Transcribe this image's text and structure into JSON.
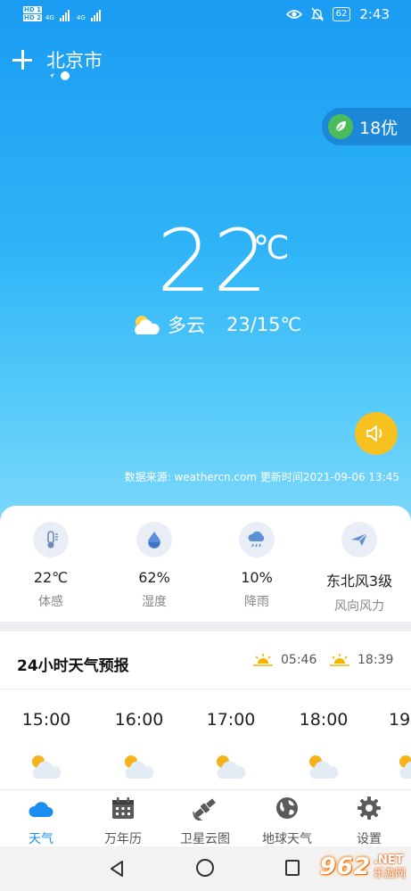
{
  "status_bar": {
    "sim1": "HD 1",
    "sim2": "HD 2",
    "net1": "4G",
    "net2": "4G",
    "battery": "62",
    "time": "2:43"
  },
  "header": {
    "city": "北京市",
    "add_icon": "plus-icon",
    "location_icon": "location-arrow-icon"
  },
  "air_quality": {
    "value": "18优",
    "icon": "leaf-icon",
    "color": "#4cbb5c"
  },
  "current": {
    "temperature": "22",
    "unit": "℃",
    "condition": "多云",
    "range": "23/15℃",
    "condition_icon": "partly-cloudy-icon"
  },
  "sound_button": {
    "icon": "speaker-icon",
    "color": "#f7c21f"
  },
  "source": "数据来源: weathercn.com 更新时间2021-09-06 13:45",
  "details": [
    {
      "icon": "thermometer-icon",
      "value": "22℃",
      "label": "体感"
    },
    {
      "icon": "droplet-icon",
      "value": "62%",
      "label": "湿度"
    },
    {
      "icon": "rain-cloud-icon",
      "value": "10%",
      "label": "降雨"
    },
    {
      "icon": "paper-plane-icon",
      "value": "东北风3级",
      "label": "风向风力"
    }
  ],
  "forecast": {
    "title": "24小时天气预报",
    "sunrise": "05:46",
    "sunset": "18:39",
    "hours": [
      {
        "time": "15:00",
        "icon": "partly-cloudy-icon"
      },
      {
        "time": "16:00",
        "icon": "partly-cloudy-icon"
      },
      {
        "time": "17:00",
        "icon": "partly-cloudy-icon"
      },
      {
        "time": "18:00",
        "icon": "partly-cloudy-icon"
      },
      {
        "time": "19",
        "icon": "partly-cloudy-icon"
      }
    ]
  },
  "bottom_nav": [
    {
      "label": "天气",
      "icon": "cloud-icon",
      "active": true
    },
    {
      "label": "万年历",
      "icon": "calendar-icon",
      "active": false
    },
    {
      "label": "卫星云图",
      "icon": "satellite-icon",
      "active": false
    },
    {
      "label": "地球天气",
      "icon": "globe-icon",
      "active": false
    },
    {
      "label": "设置",
      "icon": "gear-icon",
      "active": false
    }
  ],
  "watermark": {
    "number": "962",
    "suffix": ".NET",
    "name": "乐游网"
  },
  "colors": {
    "accent": "#1a8ef0",
    "sky_top": "#1a9cf3",
    "sky_bottom": "#7fd8fb"
  }
}
